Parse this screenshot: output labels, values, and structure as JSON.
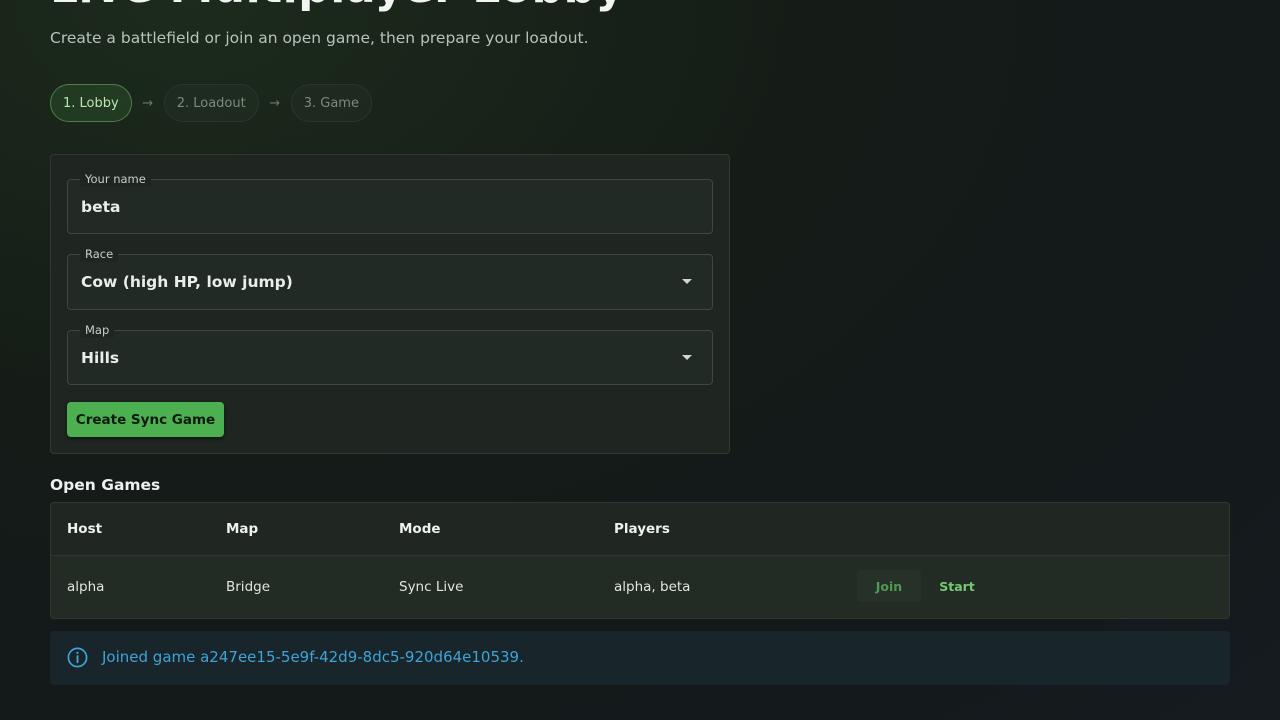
{
  "header": {
    "title": "Live Multiplayer Lobby",
    "subtitle": "Create a battlefield or join an open game, then prepare your loadout."
  },
  "stepper": {
    "steps": [
      {
        "label": "1. Lobby",
        "active": true
      },
      {
        "label": "2. Loadout",
        "active": false
      },
      {
        "label": "3. Game",
        "active": false
      }
    ],
    "separator": "→"
  },
  "form": {
    "name": {
      "label": "Your name",
      "value": "beta"
    },
    "race": {
      "label": "Race",
      "value": "Cow (high HP, low jump)"
    },
    "map": {
      "label": "Map",
      "value": "Hills"
    },
    "create_button": "Create Sync Game"
  },
  "open_games": {
    "title": "Open Games",
    "columns": [
      "Host",
      "Map",
      "Mode",
      "Players"
    ],
    "rows": [
      {
        "host": "alpha",
        "map": "Bridge",
        "mode": "Sync Live",
        "players": "alpha, beta",
        "join_label": "Join",
        "start_label": "Start"
      }
    ]
  },
  "alert": {
    "icon": "info-icon",
    "message": "Joined game a247ee15-5e9f-42d9-8dc5-920d64e10539."
  },
  "colors": {
    "accent": "#4caf50",
    "info": "#3fa3d6"
  }
}
